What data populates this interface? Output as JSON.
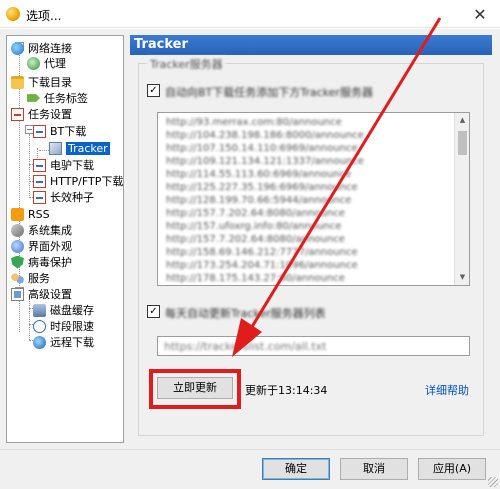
{
  "window": {
    "title": "选项...",
    "close_glyph": "✕"
  },
  "tree": {
    "items": [
      {
        "label": "网络连接",
        "icon": "globe-icon"
      },
      {
        "label": "代理",
        "icon": "proxy-icon"
      },
      {
        "label": "下载目录",
        "icon": "folder-icon"
      },
      {
        "label": "任务标签",
        "icon": "tag-icon"
      },
      {
        "label": "任务设置",
        "icon": "task-icon"
      },
      {
        "label": "BT下载",
        "icon": "bt-icon"
      },
      {
        "label": "Tracker",
        "icon": "tracker-icon",
        "selected": true
      },
      {
        "label": "电驴下载",
        "icon": "edonkey-icon"
      },
      {
        "label": "HTTP/FTP下载",
        "icon": "http-icon"
      },
      {
        "label": "长效种子",
        "icon": "seed-icon"
      },
      {
        "label": "RSS",
        "icon": "rss-icon"
      },
      {
        "label": "系统集成",
        "icon": "integration-icon"
      },
      {
        "label": "界面外观",
        "icon": "appearance-icon"
      },
      {
        "label": "病毒保护",
        "icon": "shield-icon"
      },
      {
        "label": "服务",
        "icon": "service-icon"
      },
      {
        "label": "高级设置",
        "icon": "advanced-icon"
      },
      {
        "label": "磁盘缓存",
        "icon": "disk-icon"
      },
      {
        "label": "时段限速",
        "icon": "clock-icon"
      },
      {
        "label": "远程下载",
        "icon": "remote-icon"
      }
    ],
    "expander_glyph": "−"
  },
  "panel": {
    "header": "Tracker",
    "group_title": "Tracker服务器",
    "auto_add_checkbox": {
      "checked": true,
      "mark": "✓",
      "label": "自动向BT下载任务添加下方Tracker服务器"
    },
    "tracker_list": [
      "http://93.merrax.com:80/announce",
      "http://104.238.198.186:8000/announce",
      "http://107.150.14.110:6969/announce",
      "http://109.121.134.121:1337/announce",
      "http://114.55.113.60:6969/announce",
      "http://125.227.35.196:6969/announce",
      "http://128.199.70.66:5944/announce",
      "http://157.7.202.64:8080/announce",
      "http://157.ufoxrg.info:80/announce",
      "http://157.7.202.64:8080/announce",
      "http://158.69.146.212:7777/announce",
      "http://173.254.204.71:1096/announce",
      "http://178.175.143.27:80/announce"
    ],
    "auto_update_checkbox": {
      "checked": true,
      "mark": "✓",
      "label": "每天自动更新Tracker服务器列表"
    },
    "update_url": "https://trackerslist.com/all.txt",
    "update_button": "立即更新",
    "updated_at": "更新于13:14:34",
    "help_link": "详细帮助"
  },
  "footer": {
    "ok": "确定",
    "cancel": "取消",
    "apply": "应用(A)"
  },
  "colors": {
    "annotation_red": "#e01c1c",
    "header_blue": "#2a62b4",
    "selection_blue": "#0a64c8"
  }
}
